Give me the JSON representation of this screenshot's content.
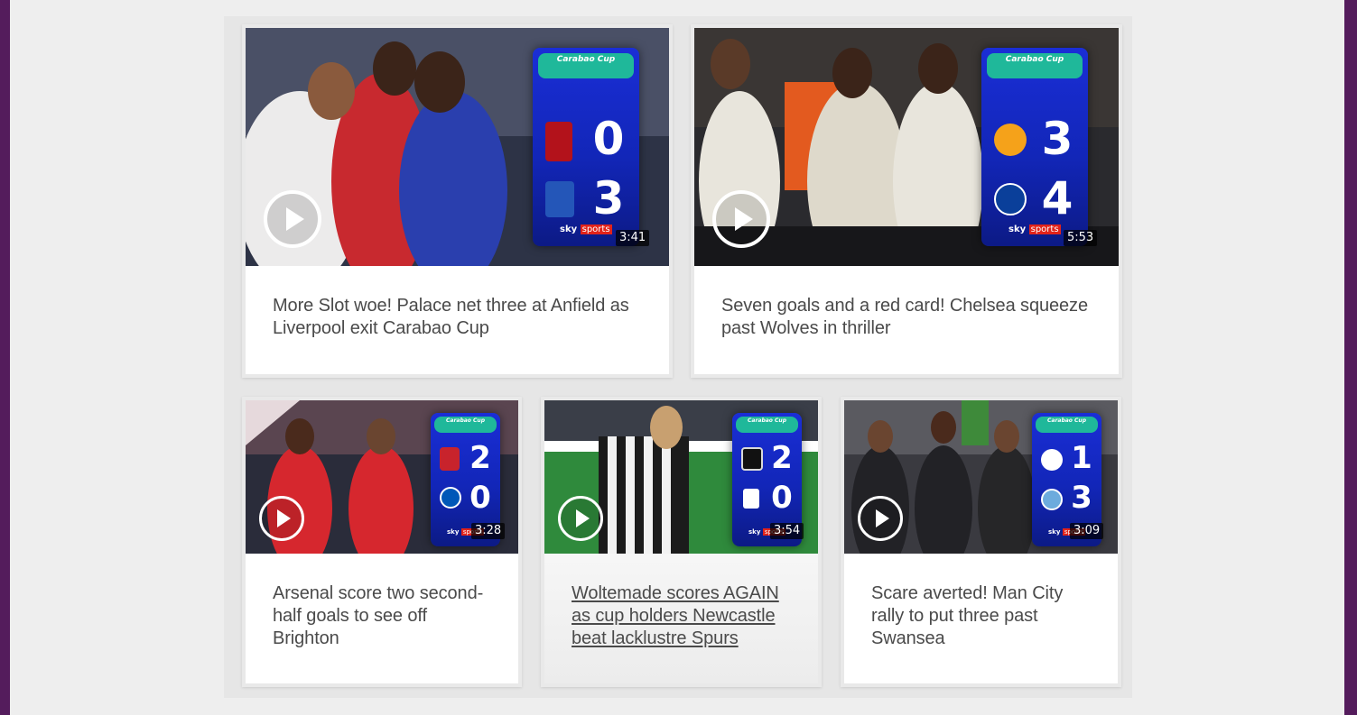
{
  "colors": {
    "frame": "#541c5c",
    "background": "#eeeeee",
    "headline_text": "#4a4a4a",
    "scoreboard_blue": "#1226b8",
    "cup_green": "#1fb89a",
    "sky_red": "#e2231a"
  },
  "videos": [
    {
      "headline": "More Slot woe! Palace net three at Anfield as Liverpool exit Carabao Cup",
      "duration": "3:41",
      "cup_label": "Carabao Cup",
      "home_score": "0",
      "away_score": "3",
      "home_crest": "liverpool-crest-icon",
      "away_crest": "crystal-palace-crest-icon",
      "broadcaster": "sky",
      "broadcaster_sub": "sports",
      "play_icon": "play-icon"
    },
    {
      "headline": "Seven goals and a red card! Chelsea squeeze past Wolves in thriller",
      "duration": "5:53",
      "cup_label": "Carabao Cup",
      "home_score": "3",
      "away_score": "4",
      "home_crest": "wolves-crest-icon",
      "away_crest": "chelsea-crest-icon",
      "broadcaster": "sky",
      "broadcaster_sub": "sports",
      "play_icon": "play-icon"
    },
    {
      "headline": "Arsenal score two second-half goals to see off Brighton",
      "duration": "3:28",
      "cup_label": "Carabao Cup",
      "home_score": "2",
      "away_score": "0",
      "home_crest": "arsenal-crest-icon",
      "away_crest": "brighton-crest-icon",
      "broadcaster": "sky",
      "broadcaster_sub": "sports",
      "play_icon": "play-icon"
    },
    {
      "headline": "Woltemade scores AGAIN as cup holders Newcastle beat lacklustre Spurs",
      "duration": "3:54",
      "cup_label": "Carabao Cup",
      "home_score": "2",
      "away_score": "0",
      "home_crest": "newcastle-crest-icon",
      "away_crest": "tottenham-crest-icon",
      "broadcaster": "sky",
      "broadcaster_sub": "sports",
      "play_icon": "play-icon",
      "hovered": true
    },
    {
      "headline": "Scare averted! Man City rally to put three past Swansea",
      "duration": "3:09",
      "cup_label": "Carabao Cup",
      "home_score": "1",
      "away_score": "3",
      "home_crest": "swansea-crest-icon",
      "away_crest": "man-city-crest-icon",
      "broadcaster": "sky",
      "broadcaster_sub": "sports",
      "play_icon": "play-icon"
    }
  ]
}
